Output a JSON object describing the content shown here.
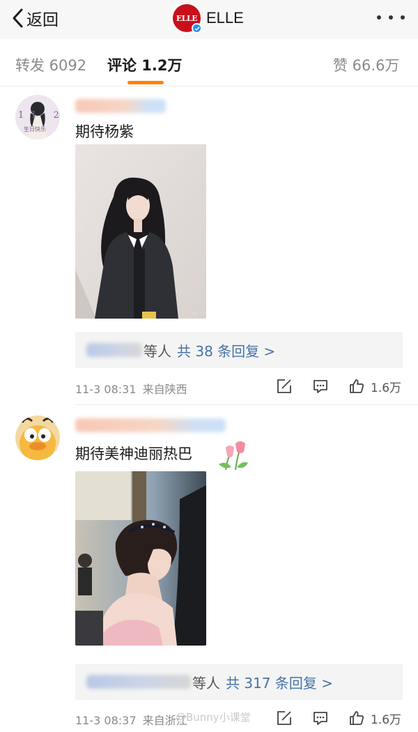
{
  "nav": {
    "back_label": "返回",
    "account_name": "ELLE",
    "avatar_text": "ELLE",
    "brand_color": "#c8101c",
    "verified_color": "#2b8ef0"
  },
  "tabs": {
    "repost": "转发 6092",
    "comment": "评论 1.2万",
    "like": "赞 66.6万",
    "active_color": "#ff8200"
  },
  "comments": [
    {
      "avatar_caption": "生日快乐",
      "avatar_numerals": "11 26",
      "text": "期待杨紫",
      "replies_tail": "等人",
      "replies_link": "共 38 条回复 >",
      "timestamp": "11-3 08:31",
      "location": "来自陕西",
      "like_count": "1.6万"
    },
    {
      "text": "期待美神迪丽热巴",
      "replies_tail": "等人",
      "replies_link": "共 317 条回复 >",
      "timestamp": "11-3 08:37",
      "location": "来自浙江",
      "like_count": "1.6万"
    }
  ],
  "link_color": "#4672a8",
  "watermark": "@Bunny小课堂"
}
